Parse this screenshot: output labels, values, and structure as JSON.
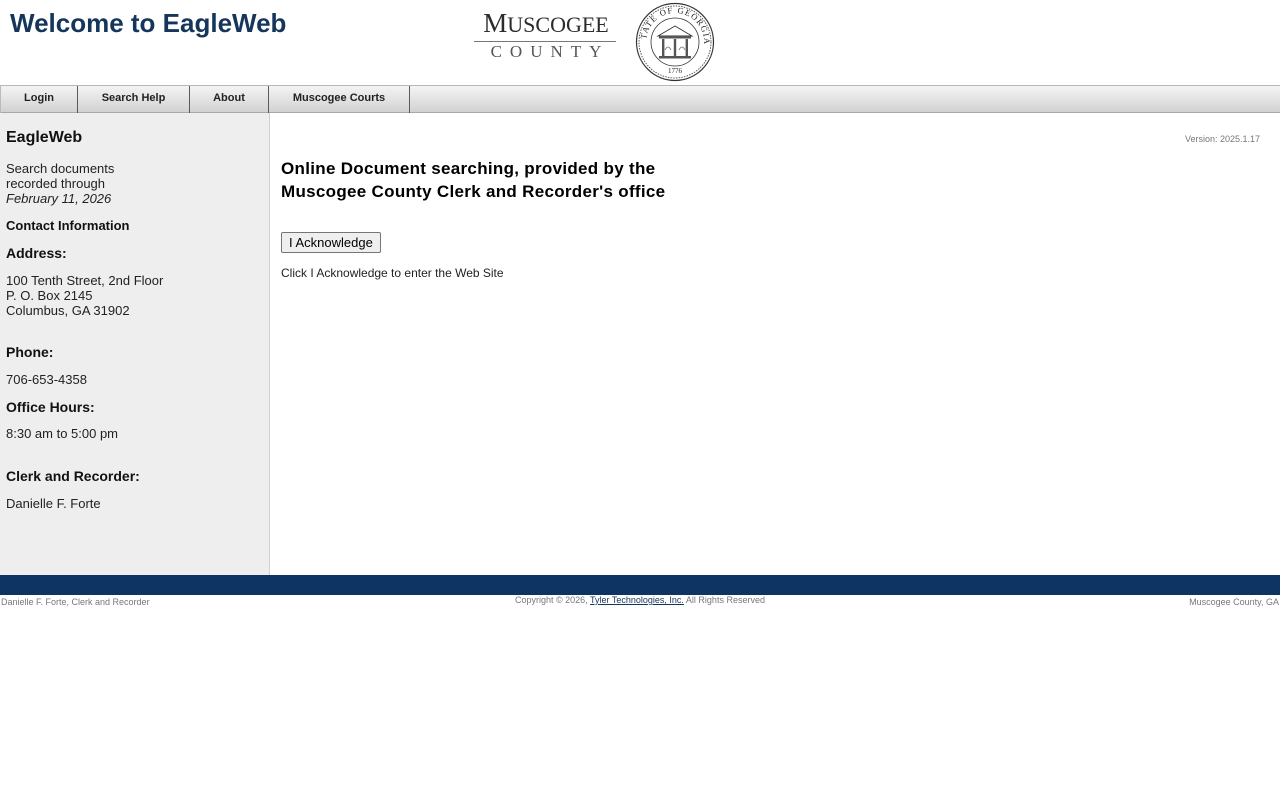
{
  "header": {
    "title": "Welcome to EagleWeb",
    "logo": {
      "line1_cap_m": "M",
      "line1_rest": "USCOGEE",
      "line2": "COUNTY"
    },
    "seal": {
      "text": "STATE OF GEORGIA",
      "year": "1776"
    }
  },
  "nav": {
    "login": "Login",
    "search_help": "Search Help",
    "about": "About",
    "courts": "Muscogee Courts"
  },
  "sidebar": {
    "title": "EagleWeb",
    "search_line1": "Search documents",
    "search_line2": "recorded through",
    "search_date": "February 11, 2026",
    "contact_heading": "Contact Information",
    "address_heading": "Address:",
    "address_line1": "100 Tenth Street, 2nd Floor",
    "address_line2": "P. O. Box 2145",
    "address_line3": "Columbus, GA 31902",
    "phone_heading": "Phone:",
    "phone": "706-653-4358",
    "hours_heading": "Office Hours:",
    "hours": "8:30 am to 5:00 pm",
    "clerk_heading": "Clerk and Recorder:",
    "clerk_name": "Danielle F. Forte"
  },
  "main": {
    "version": "Version: 2025.1.17",
    "heading": "Online Document searching, provided by the Muscogee County Clerk and Recorder's office",
    "ack_button": "I Acknowledge",
    "ack_note": "Click I Acknowledge to enter the Web Site"
  },
  "footer": {
    "left": "Danielle F. Forte, Clerk and Recorder",
    "copyright_prefix": "Copyright © 2026, ",
    "link": "Tyler Technologies, Inc.",
    "copyright_suffix": " All Rights Reserved",
    "right": "Muscogee County, GA"
  },
  "colors": {
    "brand_navy": "#0d3462",
    "title_blue": "#15365a",
    "sidebar_bg": "#eeeeee"
  }
}
